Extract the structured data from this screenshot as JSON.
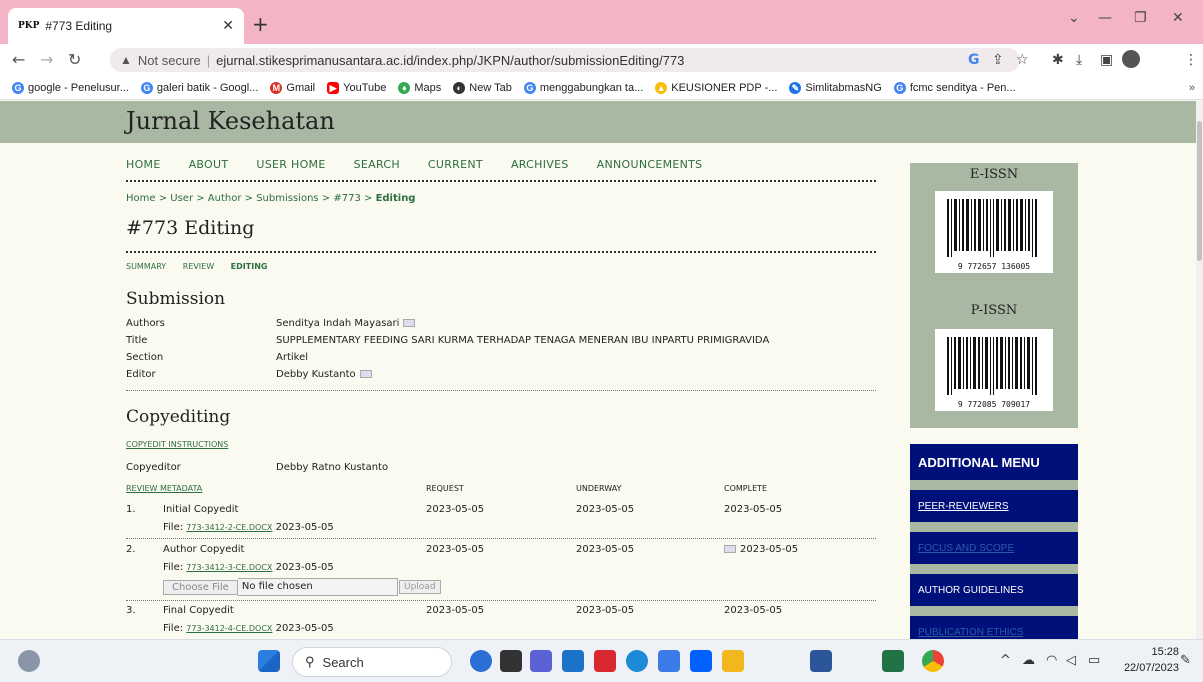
{
  "browser": {
    "tab_title": "#773 Editing",
    "tab_favicon": "PKP",
    "address_warning": "Not secure",
    "url": "ejurnal.stikesprimanusantara.ac.id/index.php/JKPN/author/submissionEditing/773",
    "bookmarks": [
      {
        "label": "google - Penelusur...",
        "color": "#4285f4",
        "glyph": "G"
      },
      {
        "label": "galeri batik - Googl...",
        "color": "#4285f4",
        "glyph": "G"
      },
      {
        "label": "Gmail",
        "color": "#d93025",
        "glyph": "M"
      },
      {
        "label": "YouTube",
        "color": "#ff0000",
        "glyph": "▶"
      },
      {
        "label": "Maps",
        "color": "#34a853",
        "glyph": "♦"
      },
      {
        "label": "New Tab",
        "color": "#333333",
        "glyph": "◐"
      },
      {
        "label": "menggabungkan ta...",
        "color": "#4285f4",
        "glyph": "G"
      },
      {
        "label": "KEUSIONER PDP -...",
        "color": "#fbbc05",
        "glyph": "▲"
      },
      {
        "label": "SimlitabmasNG",
        "color": "#1a73e8",
        "glyph": "✎"
      },
      {
        "label": "fcmc senditya - Pen...",
        "color": "#4285f4",
        "glyph": "G"
      }
    ]
  },
  "site": {
    "journal_title": "Jurnal Kesehatan",
    "nav": [
      "HOME",
      "ABOUT",
      "USER HOME",
      "SEARCH",
      "CURRENT",
      "ARCHIVES",
      "ANNOUNCEMENTS"
    ],
    "breadcrumb": "Home > User > Author > Submissions > #773 > ",
    "breadcrumb_current": "Editing",
    "page_title": "#773 Editing",
    "subtabs": [
      "SUMMARY",
      "REVIEW",
      "EDITING"
    ]
  },
  "submission": {
    "heading": "Submission",
    "rows": [
      {
        "k": "Authors",
        "v": "Senditya Indah Mayasari",
        "mail": true
      },
      {
        "k": "Title",
        "v": "SUPPLEMENTARY FEEDING SARI KURMA TERHADAP TENAGA MENERAN IBU INPARTU PRIMIGRAVIDA",
        "mail": false
      },
      {
        "k": "Section",
        "v": "Artikel",
        "mail": false
      },
      {
        "k": "Editor",
        "v": "Debby Kustanto",
        "mail": true
      }
    ]
  },
  "copyediting": {
    "heading": "Copyediting",
    "instructions_link": "COPYEDIT INSTRUCTIONS",
    "copyeditor_label": "Copyeditor",
    "copyeditor_name": "Debby Ratno Kustanto",
    "review_metadata_link": "REVIEW METADATA",
    "col_request": "REQUEST",
    "col_underway": "UNDERWAY",
    "col_complete": "COMPLETE",
    "file_prefix": "File:",
    "steps": [
      {
        "num": "1.",
        "name": "Initial Copyedit",
        "file": "773-3412-2-CE.DOCX",
        "file_date": "2023-05-05",
        "request": "2023-05-05",
        "underway": "2023-05-05",
        "complete": "2023-05-05"
      },
      {
        "num": "2.",
        "name": "Author Copyedit",
        "file": "773-3412-3-CE.DOCX",
        "file_date": "2023-05-05",
        "request": "2023-05-05",
        "underway": "2023-05-05",
        "complete": "2023-05-05"
      },
      {
        "num": "3.",
        "name": "Final Copyedit",
        "file": "773-3412-4-CE.DOCX",
        "file_date": "2023-05-05",
        "request": "2023-05-05",
        "underway": "2023-05-05",
        "complete": "2023-05-05"
      }
    ],
    "choose_file_label": "Choose File",
    "no_file_label": "No file chosen",
    "upload_label": "Upload"
  },
  "sidebar": {
    "eissn_label": "E-ISSN",
    "eissn_number": "9 772657 136005",
    "pissn_label": "P-ISSN",
    "pissn_number": "9 772085 709017",
    "menu_title": "ADDITIONAL MENU",
    "menu_items": [
      "PEER-REVIEWERS",
      "FOCUS AND SCOPE",
      "AUTHOR GUIDELINES",
      "PUBLICATION ETHICS"
    ]
  },
  "taskbar": {
    "search_label": "Search",
    "time": "15:28",
    "date": "22/07/2023"
  }
}
